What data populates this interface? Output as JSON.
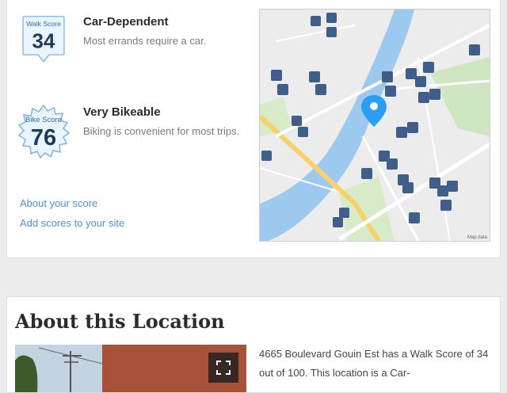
{
  "scores": {
    "walk": {
      "badge_label": "Walk Score",
      "value": "34",
      "title": "Car-Dependent",
      "description": "Most errands require a car."
    },
    "bike": {
      "badge_label": "Bike Score",
      "value": "76",
      "title": "Very Bikeable",
      "description": "Biking is convenient for most trips."
    }
  },
  "links": {
    "about_score": "About your score",
    "add_scores": "Add scores to your site"
  },
  "map": {
    "credit": "Map data",
    "pin_color": "#2a9df4",
    "water_color": "#9ec9ef",
    "icon_color": "#3f5f8a"
  },
  "about": {
    "title": "About this Location",
    "description": "4665 Boulevard Gouin Est has a Walk Score of 34 out of 100. This location is a Car-"
  },
  "colors": {
    "link": "#4a90d9",
    "badge_blue": "#2f6db5",
    "badge_bg": "#eaf4fc"
  }
}
